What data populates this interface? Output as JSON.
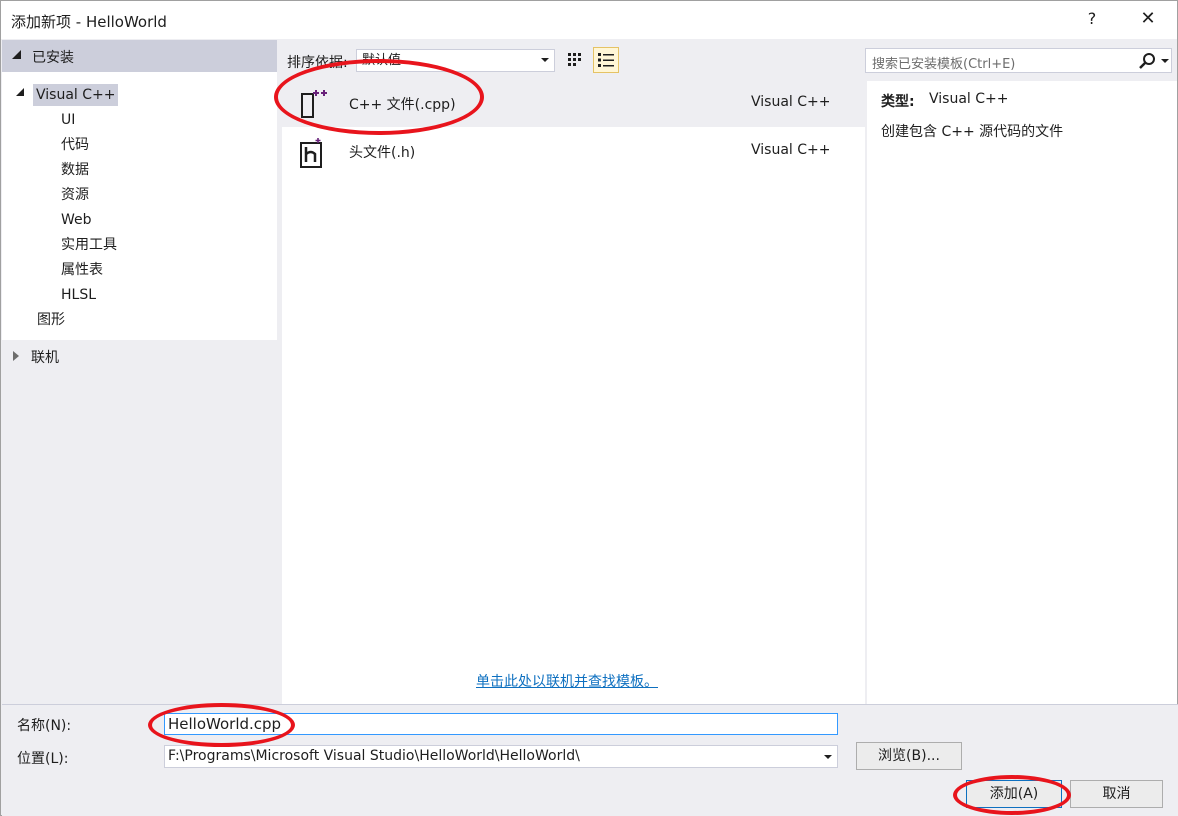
{
  "window": {
    "title": "添加新项 - HelloWorld",
    "help_label": "?",
    "close_label": "✕"
  },
  "tree": {
    "installed_label": "已安装",
    "visual_cpp_label": "Visual C++",
    "children": [
      "UI",
      "代码",
      "数据",
      "资源",
      "Web",
      "实用工具",
      "属性表",
      "HLSL"
    ],
    "graphics_label": "图形",
    "online_label": "联机"
  },
  "toolbar": {
    "sort_label": "排序依据:",
    "sort_value": "默认值",
    "search_placeholder": "搜索已安装模板(Ctrl+E)"
  },
  "templates": [
    {
      "name": "C++ 文件(.cpp)",
      "lang": "Visual C++",
      "icon": "cpp-file-icon",
      "selected": true
    },
    {
      "name": "头文件(.h)",
      "lang": "Visual C++",
      "icon": "header-file-icon",
      "selected": false
    }
  ],
  "online_link": "单击此处以联机并查找模板。",
  "detail": {
    "type_key": "类型:",
    "type_value": "Visual C++",
    "description": "创建包含 C++ 源代码的文件"
  },
  "form": {
    "name_label": "名称(N):",
    "name_value": "HelloWorld.cpp",
    "location_label": "位置(L):",
    "location_value": "F:\\Programs\\Microsoft Visual Studio\\HelloWorld\\HelloWorld\\",
    "browse_label": "浏览(B)...",
    "add_label": "添加(A)",
    "cancel_label": "取消"
  },
  "colors": {
    "annotation": "#e8141c",
    "link": "#0e70c0",
    "selection": "#cccedb",
    "icon_accent": "#68217a"
  }
}
